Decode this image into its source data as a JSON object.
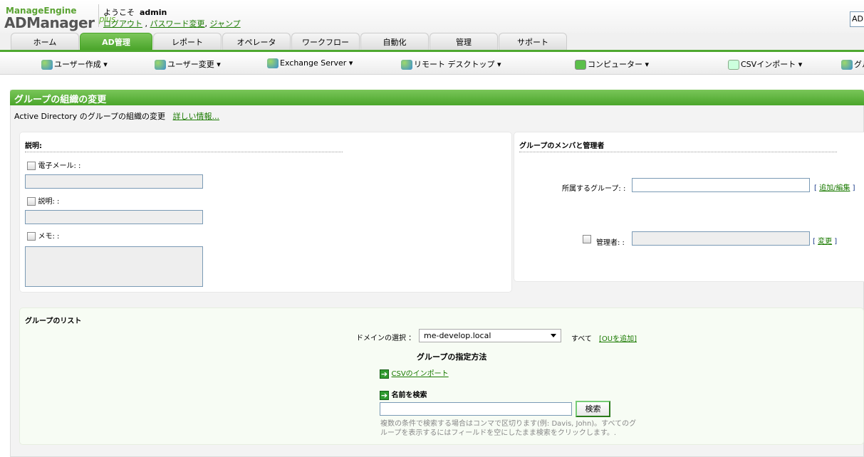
{
  "header": {
    "logo_brand": "ManageEngine",
    "logo_product": "ADManager",
    "logo_suffix": "plus",
    "welcome": "ようこそ",
    "user": "admin",
    "logout": "ログアウト",
    "change_password": "パスワード変更",
    "jump": "ジャンプ",
    "top_right_box": "AD"
  },
  "tabs": [
    "ホーム",
    "AD管理",
    "レポート",
    "オペレータ",
    "ワークフロー",
    "自動化",
    "管理",
    "サポート"
  ],
  "active_tab": "AD管理",
  "submenu": [
    "ユーザー作成",
    "ユーザー変更",
    "Exchange Server",
    "リモート デスクトップ",
    "コンピューター",
    "CSVインポート",
    "グル"
  ],
  "page": {
    "title": "グループの組織の変更",
    "description": "Active Directory のグループの組織の変更",
    "more_info": "詳しい情報..."
  },
  "left_card": {
    "section": "説明:",
    "email_label": "電子メール: :",
    "desc_label": "説明: :",
    "memo_label": "メモ: :"
  },
  "right_card": {
    "section": "グループのメンバと管理者",
    "member_of_label": "所属するグループ: :",
    "add_edit": "追加/編集",
    "manager_label": "管理者: :",
    "change": "変更"
  },
  "group_list": {
    "section": "グループのリスト",
    "domain_label": "ドメインの選択 ：",
    "domain_value": "me-develop.local",
    "all": "すべて",
    "add_ou": "[OUを追加]",
    "method_title": "グループの指定方法",
    "csv_import": "CSVのインポート",
    "search_by_name": "名前を検索",
    "search_button": "検索",
    "hint": "複数の条件で検索する場合はコンマで区切ります(例: Davis, John)。すべてのグループを表示するにはフィールドを空にしたまま検索をクリックします。."
  },
  "colors": {
    "accent": "#4ea82f",
    "link": "#1a7a00"
  }
}
